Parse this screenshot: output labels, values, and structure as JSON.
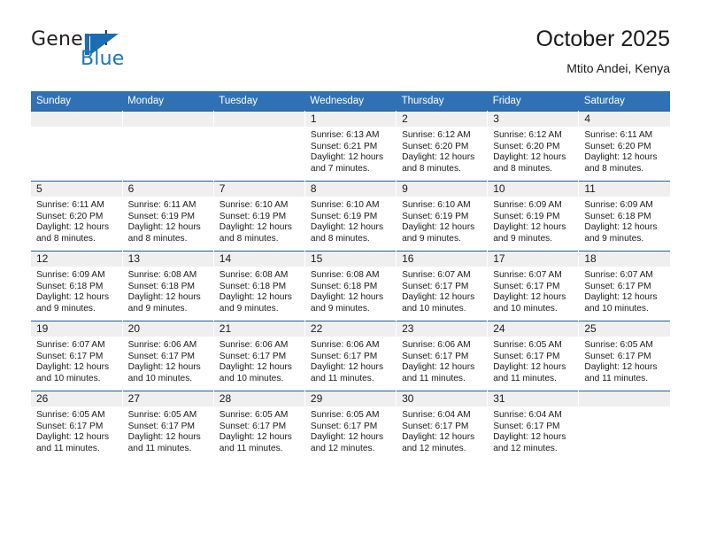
{
  "logo": {
    "word_top": "General",
    "word_bottom": "Blue",
    "mark_name": "blue-triangle-sail",
    "color_dark": "#231f20",
    "color_blue": "#1b75bc"
  },
  "header": {
    "title": "October 2025",
    "subtitle": "Mtito Andei, Kenya"
  },
  "colors": {
    "header_blue": "#3071b5",
    "row_rule_blue": "#1f5fa0",
    "daynum_band": "#efefef",
    "text": "#1a1a1a"
  },
  "calendar": {
    "weekday_headers": [
      "Sunday",
      "Monday",
      "Tuesday",
      "Wednesday",
      "Thursday",
      "Friday",
      "Saturday"
    ],
    "weeks": [
      [
        {
          "day": "",
          "sunrise": "",
          "sunset": "",
          "daylight1": "",
          "daylight2": "",
          "empty": true
        },
        {
          "day": "",
          "sunrise": "",
          "sunset": "",
          "daylight1": "",
          "daylight2": "",
          "empty": true
        },
        {
          "day": "",
          "sunrise": "",
          "sunset": "",
          "daylight1": "",
          "daylight2": "",
          "empty": true
        },
        {
          "day": "1",
          "sunrise": "Sunrise: 6:13 AM",
          "sunset": "Sunset: 6:21 PM",
          "daylight1": "Daylight: 12 hours",
          "daylight2": "and 7 minutes.",
          "empty": false
        },
        {
          "day": "2",
          "sunrise": "Sunrise: 6:12 AM",
          "sunset": "Sunset: 6:20 PM",
          "daylight1": "Daylight: 12 hours",
          "daylight2": "and 8 minutes.",
          "empty": false
        },
        {
          "day": "3",
          "sunrise": "Sunrise: 6:12 AM",
          "sunset": "Sunset: 6:20 PM",
          "daylight1": "Daylight: 12 hours",
          "daylight2": "and 8 minutes.",
          "empty": false
        },
        {
          "day": "4",
          "sunrise": "Sunrise: 6:11 AM",
          "sunset": "Sunset: 6:20 PM",
          "daylight1": "Daylight: 12 hours",
          "daylight2": "and 8 minutes.",
          "empty": false
        }
      ],
      [
        {
          "day": "5",
          "sunrise": "Sunrise: 6:11 AM",
          "sunset": "Sunset: 6:20 PM",
          "daylight1": "Daylight: 12 hours",
          "daylight2": "and 8 minutes.",
          "empty": false
        },
        {
          "day": "6",
          "sunrise": "Sunrise: 6:11 AM",
          "sunset": "Sunset: 6:19 PM",
          "daylight1": "Daylight: 12 hours",
          "daylight2": "and 8 minutes.",
          "empty": false
        },
        {
          "day": "7",
          "sunrise": "Sunrise: 6:10 AM",
          "sunset": "Sunset: 6:19 PM",
          "daylight1": "Daylight: 12 hours",
          "daylight2": "and 8 minutes.",
          "empty": false
        },
        {
          "day": "8",
          "sunrise": "Sunrise: 6:10 AM",
          "sunset": "Sunset: 6:19 PM",
          "daylight1": "Daylight: 12 hours",
          "daylight2": "and 8 minutes.",
          "empty": false
        },
        {
          "day": "9",
          "sunrise": "Sunrise: 6:10 AM",
          "sunset": "Sunset: 6:19 PM",
          "daylight1": "Daylight: 12 hours",
          "daylight2": "and 9 minutes.",
          "empty": false
        },
        {
          "day": "10",
          "sunrise": "Sunrise: 6:09 AM",
          "sunset": "Sunset: 6:19 PM",
          "daylight1": "Daylight: 12 hours",
          "daylight2": "and 9 minutes.",
          "empty": false
        },
        {
          "day": "11",
          "sunrise": "Sunrise: 6:09 AM",
          "sunset": "Sunset: 6:18 PM",
          "daylight1": "Daylight: 12 hours",
          "daylight2": "and 9 minutes.",
          "empty": false
        }
      ],
      [
        {
          "day": "12",
          "sunrise": "Sunrise: 6:09 AM",
          "sunset": "Sunset: 6:18 PM",
          "daylight1": "Daylight: 12 hours",
          "daylight2": "and 9 minutes.",
          "empty": false
        },
        {
          "day": "13",
          "sunrise": "Sunrise: 6:08 AM",
          "sunset": "Sunset: 6:18 PM",
          "daylight1": "Daylight: 12 hours",
          "daylight2": "and 9 minutes.",
          "empty": false
        },
        {
          "day": "14",
          "sunrise": "Sunrise: 6:08 AM",
          "sunset": "Sunset: 6:18 PM",
          "daylight1": "Daylight: 12 hours",
          "daylight2": "and 9 minutes.",
          "empty": false
        },
        {
          "day": "15",
          "sunrise": "Sunrise: 6:08 AM",
          "sunset": "Sunset: 6:18 PM",
          "daylight1": "Daylight: 12 hours",
          "daylight2": "and 9 minutes.",
          "empty": false
        },
        {
          "day": "16",
          "sunrise": "Sunrise: 6:07 AM",
          "sunset": "Sunset: 6:17 PM",
          "daylight1": "Daylight: 12 hours",
          "daylight2": "and 10 minutes.",
          "empty": false
        },
        {
          "day": "17",
          "sunrise": "Sunrise: 6:07 AM",
          "sunset": "Sunset: 6:17 PM",
          "daylight1": "Daylight: 12 hours",
          "daylight2": "and 10 minutes.",
          "empty": false
        },
        {
          "day": "18",
          "sunrise": "Sunrise: 6:07 AM",
          "sunset": "Sunset: 6:17 PM",
          "daylight1": "Daylight: 12 hours",
          "daylight2": "and 10 minutes.",
          "empty": false
        }
      ],
      [
        {
          "day": "19",
          "sunrise": "Sunrise: 6:07 AM",
          "sunset": "Sunset: 6:17 PM",
          "daylight1": "Daylight: 12 hours",
          "daylight2": "and 10 minutes.",
          "empty": false
        },
        {
          "day": "20",
          "sunrise": "Sunrise: 6:06 AM",
          "sunset": "Sunset: 6:17 PM",
          "daylight1": "Daylight: 12 hours",
          "daylight2": "and 10 minutes.",
          "empty": false
        },
        {
          "day": "21",
          "sunrise": "Sunrise: 6:06 AM",
          "sunset": "Sunset: 6:17 PM",
          "daylight1": "Daylight: 12 hours",
          "daylight2": "and 10 minutes.",
          "empty": false
        },
        {
          "day": "22",
          "sunrise": "Sunrise: 6:06 AM",
          "sunset": "Sunset: 6:17 PM",
          "daylight1": "Daylight: 12 hours",
          "daylight2": "and 11 minutes.",
          "empty": false
        },
        {
          "day": "23",
          "sunrise": "Sunrise: 6:06 AM",
          "sunset": "Sunset: 6:17 PM",
          "daylight1": "Daylight: 12 hours",
          "daylight2": "and 11 minutes.",
          "empty": false
        },
        {
          "day": "24",
          "sunrise": "Sunrise: 6:05 AM",
          "sunset": "Sunset: 6:17 PM",
          "daylight1": "Daylight: 12 hours",
          "daylight2": "and 11 minutes.",
          "empty": false
        },
        {
          "day": "25",
          "sunrise": "Sunrise: 6:05 AM",
          "sunset": "Sunset: 6:17 PM",
          "daylight1": "Daylight: 12 hours",
          "daylight2": "and 11 minutes.",
          "empty": false
        }
      ],
      [
        {
          "day": "26",
          "sunrise": "Sunrise: 6:05 AM",
          "sunset": "Sunset: 6:17 PM",
          "daylight1": "Daylight: 12 hours",
          "daylight2": "and 11 minutes.",
          "empty": false
        },
        {
          "day": "27",
          "sunrise": "Sunrise: 6:05 AM",
          "sunset": "Sunset: 6:17 PM",
          "daylight1": "Daylight: 12 hours",
          "daylight2": "and 11 minutes.",
          "empty": false
        },
        {
          "day": "28",
          "sunrise": "Sunrise: 6:05 AM",
          "sunset": "Sunset: 6:17 PM",
          "daylight1": "Daylight: 12 hours",
          "daylight2": "and 11 minutes.",
          "empty": false
        },
        {
          "day": "29",
          "sunrise": "Sunrise: 6:05 AM",
          "sunset": "Sunset: 6:17 PM",
          "daylight1": "Daylight: 12 hours",
          "daylight2": "and 12 minutes.",
          "empty": false
        },
        {
          "day": "30",
          "sunrise": "Sunrise: 6:04 AM",
          "sunset": "Sunset: 6:17 PM",
          "daylight1": "Daylight: 12 hours",
          "daylight2": "and 12 minutes.",
          "empty": false
        },
        {
          "day": "31",
          "sunrise": "Sunrise: 6:04 AM",
          "sunset": "Sunset: 6:17 PM",
          "daylight1": "Daylight: 12 hours",
          "daylight2": "and 12 minutes.",
          "empty": false
        },
        {
          "day": "",
          "sunrise": "",
          "sunset": "",
          "daylight1": "",
          "daylight2": "",
          "empty": true
        }
      ]
    ]
  }
}
